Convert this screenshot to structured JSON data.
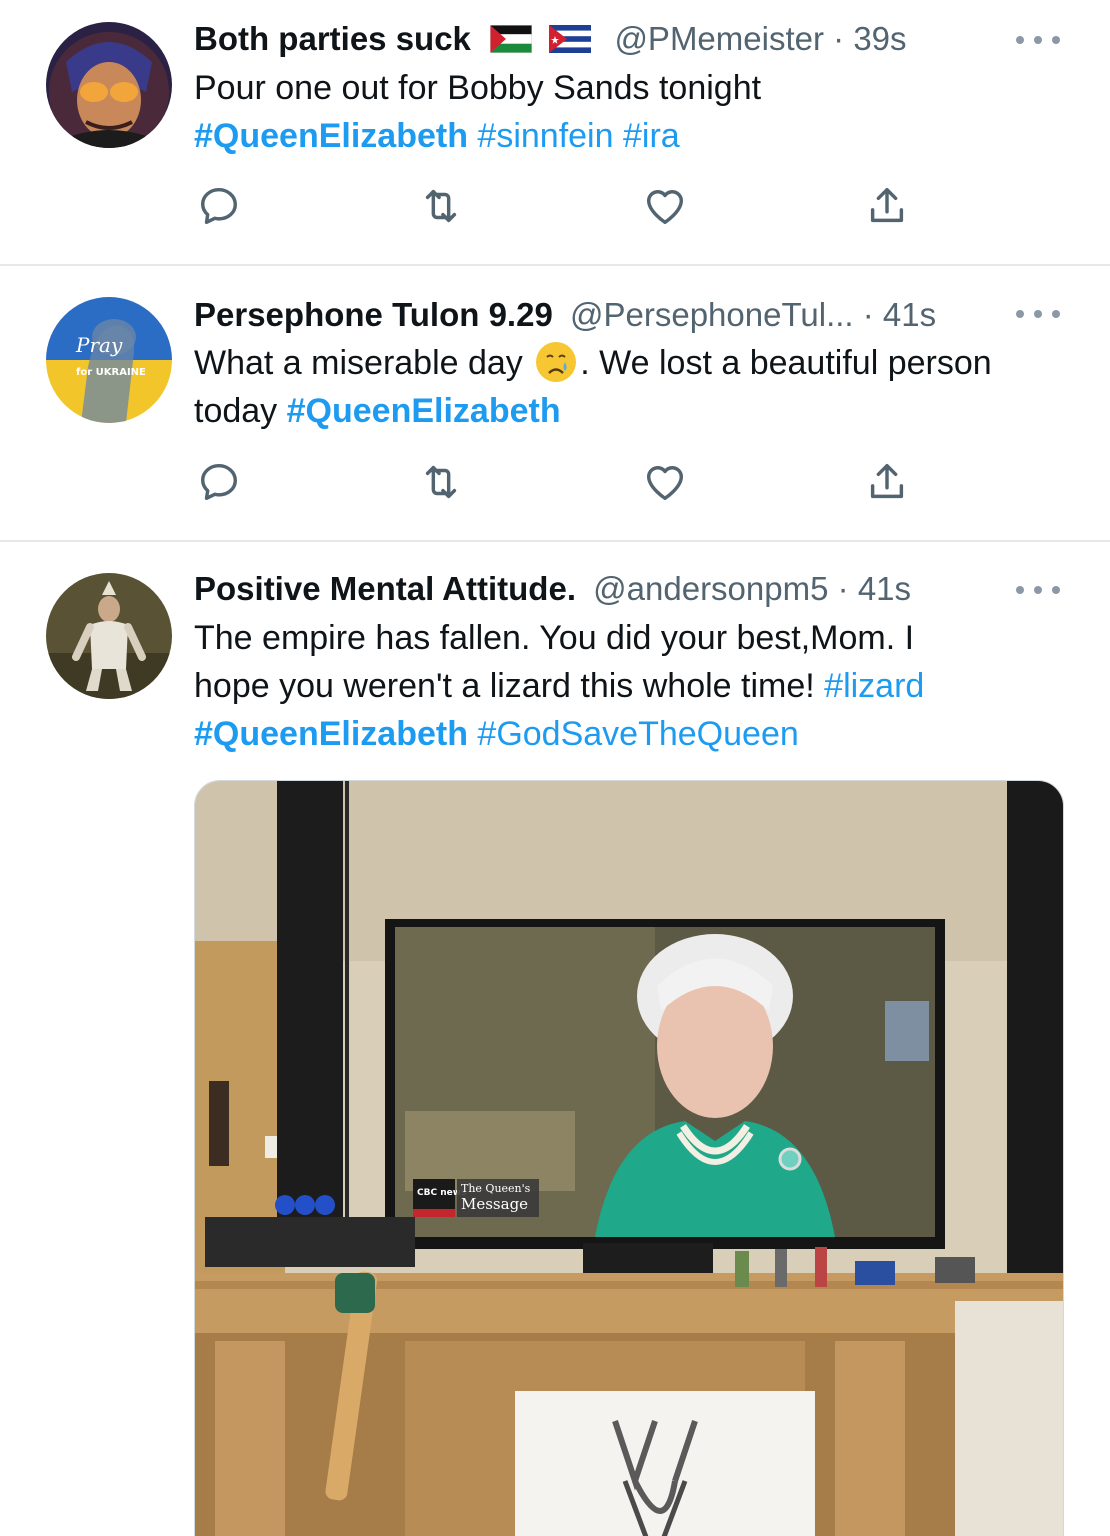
{
  "tweets": [
    {
      "name": "Both parties suck",
      "handle": "@PMemeister",
      "sep": "·",
      "time": "39s",
      "text_plain": "Pour one out for Bobby Sands tonight",
      "tags": [
        "#QueenElizabeth",
        "#sinnfein",
        "#ira"
      ]
    },
    {
      "name": "Persephone Tulon 9.29",
      "handle": "@PersephoneTul...",
      "sep": "·",
      "time": "41s",
      "text_part1": "What a miserable day",
      "text_part2": ". We lost a beautiful person",
      "text_part3": "today",
      "tags": [
        "#QueenElizabeth"
      ],
      "avatar_text": "Pray",
      "avatar_text2": "for UKRAINE"
    },
    {
      "name": "Positive Mental Attitude.",
      "handle": "@andersonpm5",
      "sep": "·",
      "time": "41s",
      "text_line1": "The empire has fallen. You did your best,Mom. I",
      "text_line2": "hope you weren't a lizard this whole time!",
      "tags": [
        "#lizard",
        "#QueenElizabeth",
        "#GodSaveTheQueen"
      ],
      "media": {
        "badge_line1": "The Queen's",
        "badge_line2": "Message",
        "network": "CBC news"
      }
    }
  ],
  "icons": [
    "reply-icon",
    "retweet-icon",
    "like-icon",
    "share-icon",
    "more-icon"
  ],
  "colors": {
    "link": "#1d9bf0",
    "secondary": "#536471",
    "divider": "#e6e9eb"
  }
}
